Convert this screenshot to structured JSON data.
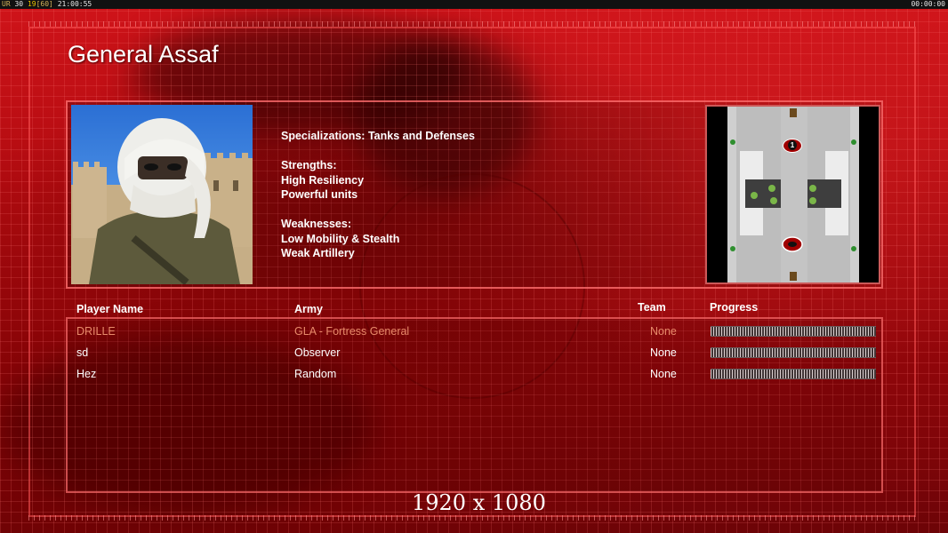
{
  "hud": {
    "ur_label": "UR",
    "val1": "30",
    "val2": "19",
    "val3": "60",
    "clock": "21:00:55",
    "timer": "00:00:00"
  },
  "general": {
    "name": "General Assaf",
    "specializations": "Specializations: Tanks and Defenses",
    "strengths_heading": "Strengths:",
    "strengths": [
      "High Resiliency",
      "Powerful units"
    ],
    "weaknesses_heading": "Weaknesses:",
    "weaknesses": [
      "Low Mobility & Stealth",
      "Weak Artillery"
    ]
  },
  "minimap": {
    "start_label_top": "1"
  },
  "table": {
    "headers": {
      "player": "Player Name",
      "army": "Army",
      "team": "Team",
      "progress": "Progress"
    },
    "rows": [
      {
        "player": "DRILLE",
        "army": "GLA - Fortress General",
        "team": "None",
        "progress": 1.0
      },
      {
        "player": "sd",
        "army": "Observer",
        "team": "None",
        "progress": 1.0
      },
      {
        "player": "Hez",
        "army": "Random",
        "team": "None",
        "progress": 1.0
      }
    ]
  },
  "resolution": "1920 x 1080",
  "colors": {
    "accent": "#c9141a",
    "dim_row": "#e88a6a"
  }
}
